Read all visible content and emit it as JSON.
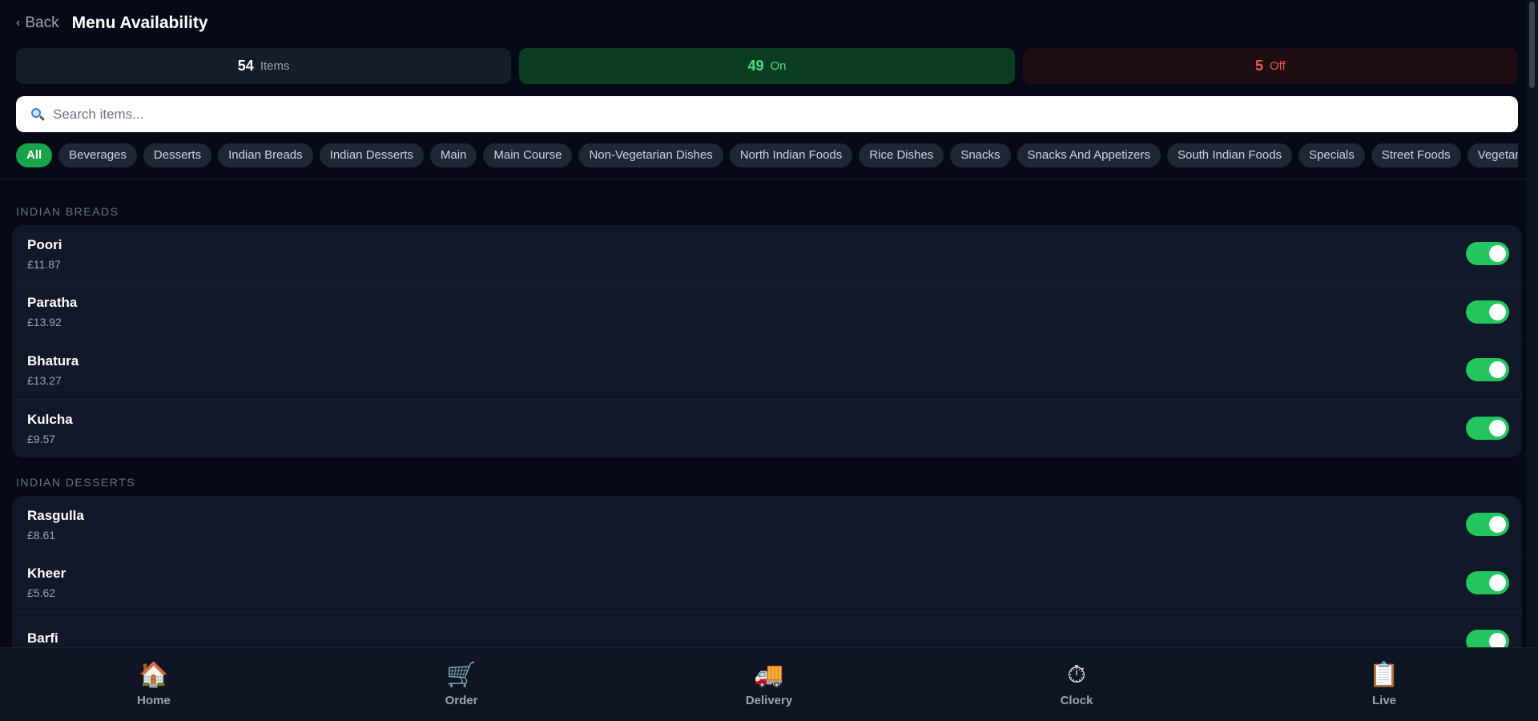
{
  "header": {
    "back_label": "Back",
    "title": "Menu Availability"
  },
  "stats": {
    "total": {
      "value": "54",
      "label": "Items"
    },
    "on": {
      "value": "49",
      "label": "On"
    },
    "off": {
      "value": "5",
      "label": "Off"
    }
  },
  "search": {
    "placeholder": "Search items..."
  },
  "categories": [
    "All",
    "Beverages",
    "Desserts",
    "Indian Breads",
    "Indian Desserts",
    "Main",
    "Main Course",
    "Non-Vegetarian Dishes",
    "North Indian Foods",
    "Rice Dishes",
    "Snacks",
    "Snacks And Appetizers",
    "South Indian Foods",
    "Specials",
    "Street Foods",
    "Vegetarian"
  ],
  "active_category": "All",
  "sections": [
    {
      "title": "INDIAN BREADS",
      "items": [
        {
          "name": "Poori",
          "price": "£11.87",
          "available": true
        },
        {
          "name": "Paratha",
          "price": "£13.92",
          "available": true
        },
        {
          "name": "Bhatura",
          "price": "£13.27",
          "available": true
        },
        {
          "name": "Kulcha",
          "price": "£9.57",
          "available": true
        }
      ]
    },
    {
      "title": "INDIAN DESSERTS",
      "items": [
        {
          "name": "Rasgulla",
          "price": "£8.61",
          "available": true
        },
        {
          "name": "Kheer",
          "price": "£5.62",
          "available": true
        },
        {
          "name": "Barfi",
          "price": "",
          "available": true
        }
      ]
    }
  ],
  "bottom_nav": [
    {
      "label": "Home",
      "icon": "house-icon",
      "glyph": "🏠"
    },
    {
      "label": "Order",
      "icon": "cart-icon",
      "glyph": "🛒"
    },
    {
      "label": "Delivery",
      "icon": "truck-icon",
      "glyph": "🚚"
    },
    {
      "label": "Clock",
      "icon": "stopwatch-icon",
      "glyph": "⏱"
    },
    {
      "label": "Live",
      "icon": "clipboard-icon",
      "glyph": "📋"
    }
  ],
  "colors": {
    "accent_green": "#22c55e",
    "off_red": "#f05252",
    "background": "#050a16",
    "card": "#111827"
  }
}
